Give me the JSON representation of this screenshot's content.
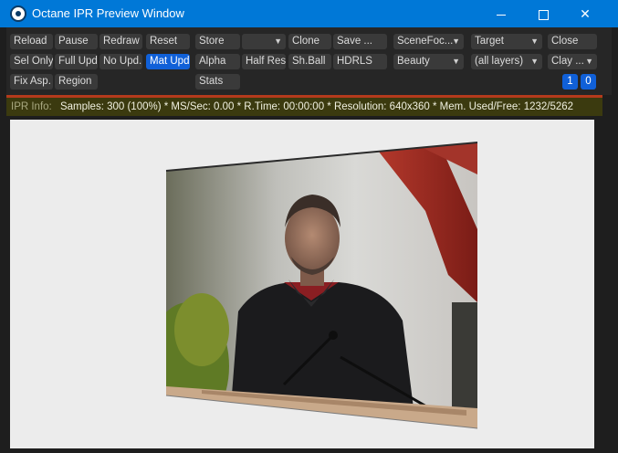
{
  "window": {
    "title": "Octane IPR Preview Window",
    "controls": {
      "minimize": "—",
      "maximize": "☐",
      "close": "✕"
    }
  },
  "toolbar": {
    "row1": {
      "reload": "Reload",
      "pause": "Pause",
      "redraw": "Redraw",
      "reset": "Reset",
      "store": "Store",
      "store_dropdown": "",
      "clone": "Clone",
      "save": "Save ...",
      "scene_focus": "SceneFoc...",
      "target": "Target",
      "close": "Close"
    },
    "row2": {
      "sel_only": "Sel Only",
      "full_upd": "Full Upd.",
      "no_upd": "No Upd.",
      "mat_upd": "Mat Upd",
      "alpha": "Alpha",
      "half_res": "Half Res",
      "sh_ball": "Sh.Ball",
      "hdrls": "HDRLS",
      "beauty": "Beauty",
      "all_layers": "(all layers)",
      "clay": "Clay ..."
    },
    "row3": {
      "fix_asp": "Fix Asp.",
      "region": "Region",
      "stats": "Stats",
      "num1": "1",
      "num2": "0"
    }
  },
  "info": {
    "label": "IPR Info:",
    "text": "Samples: 300 (100%)  *  MS/Sec: 0.00  *  R.Time: 00:00:00  *  Resolution: 640x360  *  Mem. Used/Free: 1232/5262"
  },
  "render": {
    "description_icon": "rendered-scene-image"
  }
}
